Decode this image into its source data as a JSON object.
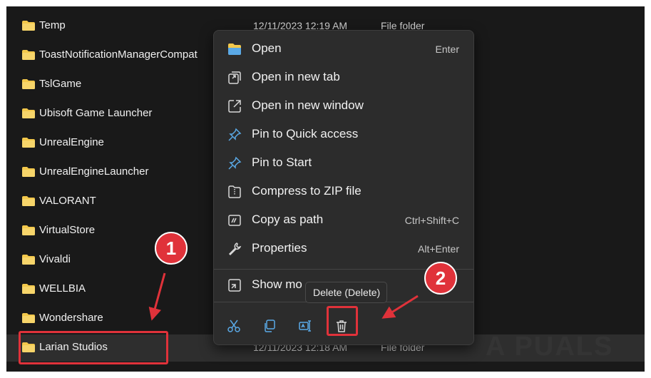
{
  "files": [
    {
      "name": "Temp",
      "date": "12/11/2023 12:19 AM",
      "type": "File folder"
    },
    {
      "name": "ToastNotificationManagerCompat",
      "date": "",
      "type": ""
    },
    {
      "name": "TslGame",
      "date": "",
      "type": ""
    },
    {
      "name": "Ubisoft Game Launcher",
      "date": "",
      "type": ""
    },
    {
      "name": "UnrealEngine",
      "date": "",
      "type": ""
    },
    {
      "name": "UnrealEngineLauncher",
      "date": "",
      "type": ""
    },
    {
      "name": "VALORANT",
      "date": "",
      "type": ""
    },
    {
      "name": "VirtualStore",
      "date": "",
      "type": ""
    },
    {
      "name": "Vivaldi",
      "date": "",
      "type": ""
    },
    {
      "name": "WELLBIA",
      "date": "",
      "type": ""
    },
    {
      "name": "Wondershare",
      "date": "",
      "type": ""
    },
    {
      "name": "Larian Studios",
      "date": "12/11/2023 12:18 AM",
      "type": "File folder"
    }
  ],
  "context_menu": {
    "items": [
      {
        "label": "Open",
        "shortcut": "Enter",
        "icon": "folder-open-icon"
      },
      {
        "label": "Open in new tab",
        "shortcut": "",
        "icon": "new-tab-icon"
      },
      {
        "label": "Open in new window",
        "shortcut": "",
        "icon": "new-window-icon"
      },
      {
        "label": "Pin to Quick access",
        "shortcut": "",
        "icon": "pin-icon"
      },
      {
        "label": "Pin to Start",
        "shortcut": "",
        "icon": "pin-icon"
      },
      {
        "label": "Compress to ZIP file",
        "shortcut": "",
        "icon": "zip-icon"
      },
      {
        "label": "Copy as path",
        "shortcut": "Ctrl+Shift+C",
        "icon": "copy-path-icon"
      },
      {
        "label": "Properties",
        "shortcut": "Alt+Enter",
        "icon": "wrench-icon"
      }
    ],
    "show_more": {
      "label": "Show mo",
      "icon": "show-more-icon"
    },
    "quick_actions": [
      "cut-icon",
      "copy-icon",
      "rename-icon",
      "trash-icon"
    ]
  },
  "tooltip": {
    "text": "Delete (Delete)"
  },
  "annotations": {
    "step1": "1",
    "step2": "2",
    "color": "#e0323a"
  },
  "watermark": {
    "text": "A PUALS"
  },
  "colors": {
    "background": "#191919",
    "menu": "#2c2c2c",
    "folder": "#f3c84b",
    "accent": "#e0323a"
  }
}
